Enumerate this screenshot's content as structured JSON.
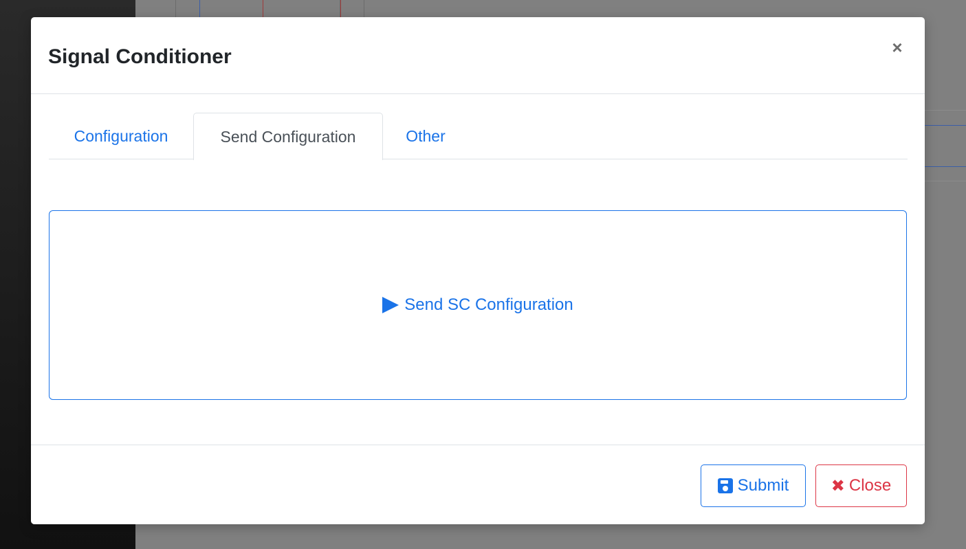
{
  "modal": {
    "title": "Signal Conditioner",
    "close_symbol": "×"
  },
  "tabs": [
    {
      "label": "Configuration",
      "active": false
    },
    {
      "label": "Send Configuration",
      "active": true
    },
    {
      "label": "Other",
      "active": false
    }
  ],
  "send_panel": {
    "action_label": "Send SC Configuration",
    "icon": "play-icon"
  },
  "footer": {
    "submit_label": "Submit",
    "submit_icon": "save-icon",
    "close_label": "Close",
    "close_icon": "times-icon",
    "close_symbol": "✖"
  },
  "colors": {
    "primary": "#1a73e8",
    "danger": "#dc3545",
    "text": "#212529",
    "muted_tab": "#495057",
    "overlay": "#808080"
  }
}
